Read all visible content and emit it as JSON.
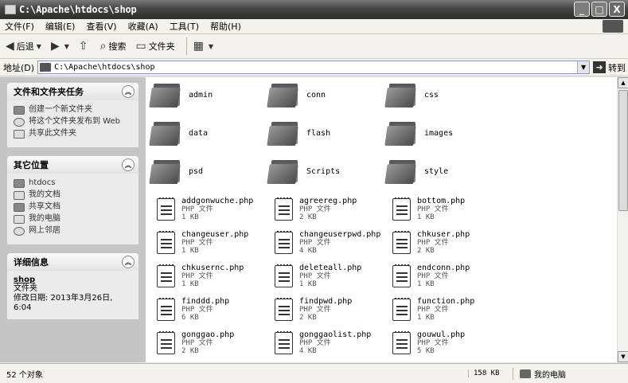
{
  "window": {
    "title": "C:\\Apache\\htdocs\\shop"
  },
  "window_buttons": {
    "minimize": "_",
    "maximize": "□",
    "close": "X"
  },
  "menu": [
    "文件(F)",
    "编辑(E)",
    "查看(V)",
    "收藏(A)",
    "工具(T)",
    "帮助(H)"
  ],
  "toolbar": {
    "back": "后退",
    "search": "搜索",
    "folders": "文件夹"
  },
  "address": {
    "label": "地址(D)",
    "value": "C:\\Apache\\htdocs\\shop",
    "go": "转到"
  },
  "tasks": {
    "title": "文件和文件夹任务",
    "items": [
      "创建一个新文件夹",
      "将这个文件夹发布到 Web",
      "共享此文件夹"
    ]
  },
  "places": {
    "title": "其它位置",
    "items": [
      "htdocs",
      "我的文档",
      "共享文档",
      "我的电脑",
      "网上邻居"
    ]
  },
  "details": {
    "title": "详细信息",
    "name": "shop",
    "type": "文件夹",
    "modified": "修改日期: 2013年3月26日, 6:04"
  },
  "folders": [
    "admin",
    "conn",
    "css",
    "data",
    "flash",
    "images",
    "psd",
    "Scripts",
    "style"
  ],
  "files": [
    {
      "name": "addgonwuche.php",
      "type": "PHP 文件",
      "size": "1 KB"
    },
    {
      "name": "agreereg.php",
      "type": "PHP 文件",
      "size": "2 KB"
    },
    {
      "name": "bottom.php",
      "type": "PHP 文件",
      "size": "1 KB"
    },
    {
      "name": "changeuser.php",
      "type": "PHP 文件",
      "size": "1 KB"
    },
    {
      "name": "changeuserpwd.php",
      "type": "PHP 文件",
      "size": "4 KB"
    },
    {
      "name": "chkuser.php",
      "type": "PHP 文件",
      "size": "2 KB"
    },
    {
      "name": "chkusernc.php",
      "type": "PHP 文件",
      "size": "1 KB"
    },
    {
      "name": "deleteall.php",
      "type": "PHP 文件",
      "size": "1 KB"
    },
    {
      "name": "endconn.php",
      "type": "PHP 文件",
      "size": "1 KB"
    },
    {
      "name": "finddd.php",
      "type": "PHP 文件",
      "size": "6 KB"
    },
    {
      "name": "findpwd.php",
      "type": "PHP 文件",
      "size": "2 KB"
    },
    {
      "name": "function.php",
      "type": "PHP 文件",
      "size": "1 KB"
    },
    {
      "name": "gonggao.php",
      "type": "PHP 文件",
      "size": "2 KB"
    },
    {
      "name": "gonggaolist.php",
      "type": "PHP 文件",
      "size": "4 KB"
    },
    {
      "name": "gouwul.php",
      "type": "PHP 文件",
      "size": "5 KB"
    }
  ],
  "status": {
    "count": "52 个对象",
    "size": "158 KB",
    "location": "我的电脑"
  }
}
